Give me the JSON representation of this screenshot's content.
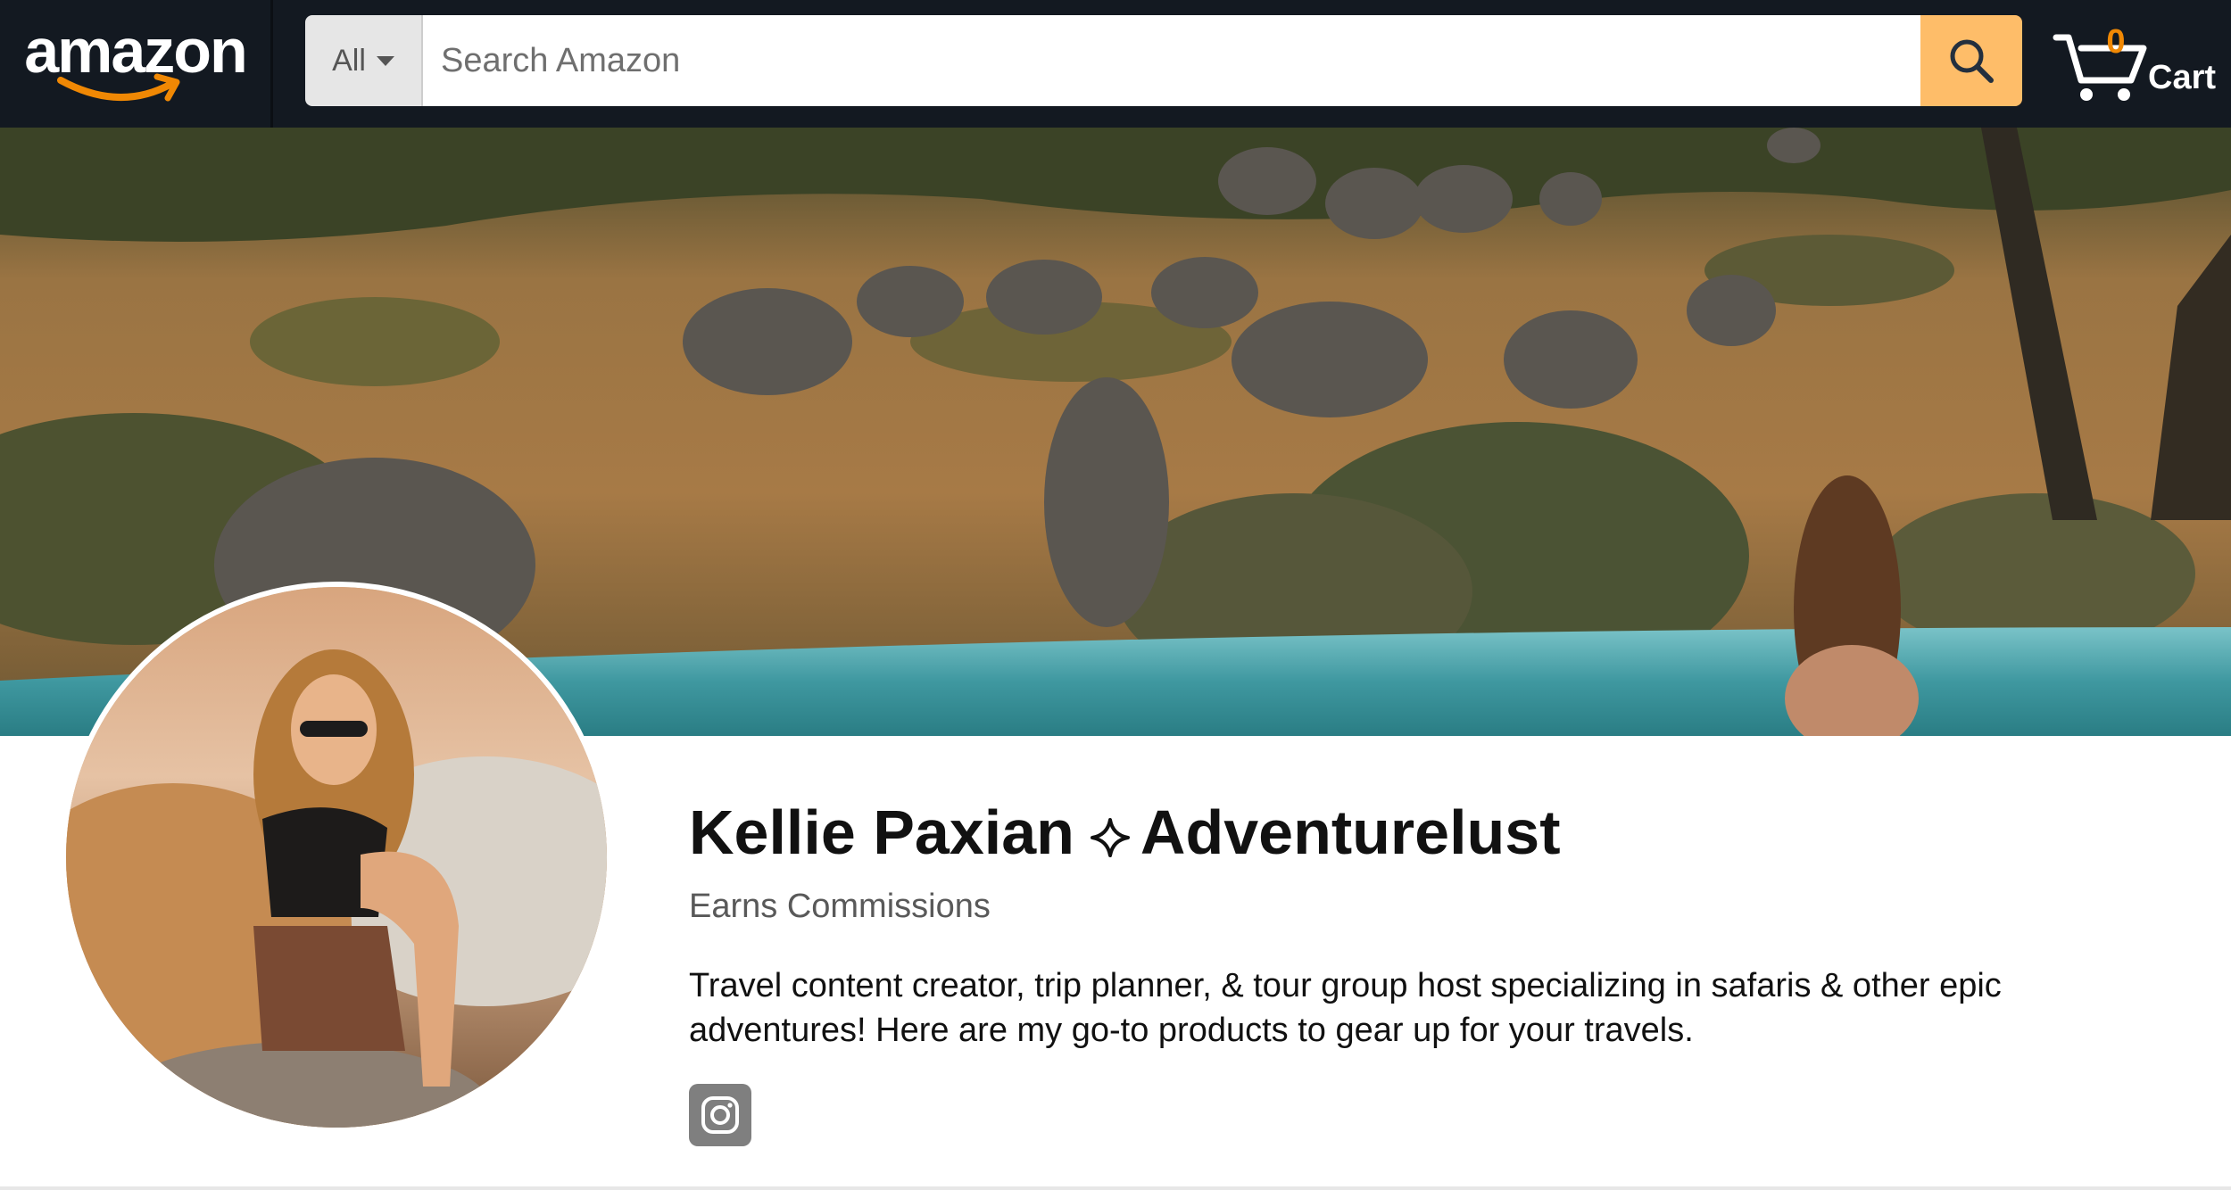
{
  "header": {
    "logo_text": "amazon",
    "search": {
      "department": "All",
      "placeholder": "Search Amazon",
      "button_icon": "search-icon"
    },
    "cart": {
      "count": "0",
      "label": "Cart",
      "icon": "cart-icon"
    }
  },
  "profile": {
    "name_first": "Kellie Paxian",
    "separator_icon": "sparkle-icon",
    "name_second": "Adventurelust",
    "status": "Earns Commissions",
    "bio": "Travel content creator, trip planner, & tour group host specializing in safaris & other epic adventures! Here are my go-to products to gear up for your travels.",
    "social_icon": "instagram-icon"
  },
  "colors": {
    "nav_bg": "#131921",
    "search_button": "#febd69",
    "cart_count": "#f08804",
    "text_primary": "#111111",
    "text_secondary": "#595959"
  }
}
